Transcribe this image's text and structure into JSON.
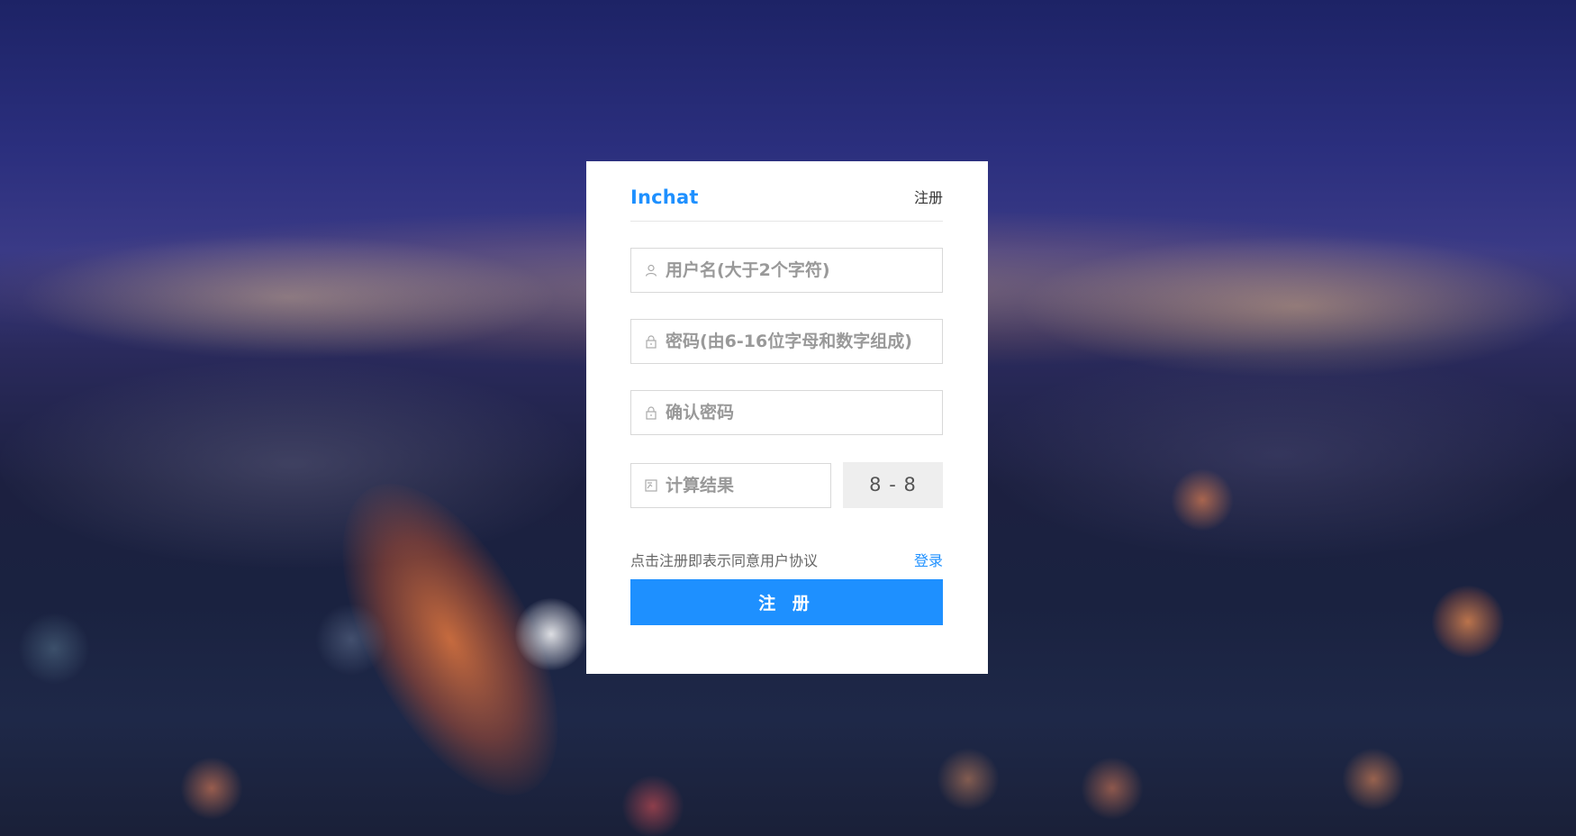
{
  "header": {
    "brand": "Inchat",
    "tab_label": "注册"
  },
  "form": {
    "username": {
      "placeholder": "用户名(大于2个字符)",
      "value": "",
      "icon": "user-icon"
    },
    "password": {
      "placeholder": "密码(由6-16位字母和数字组成)",
      "value": "",
      "icon": "lock-icon"
    },
    "confirm_password": {
      "placeholder": "确认密码",
      "value": "",
      "icon": "lock-icon"
    },
    "captcha": {
      "placeholder": "计算结果",
      "value": "",
      "icon": "calculator-icon",
      "question": "8 - 8"
    }
  },
  "footer": {
    "agreement_text": "点击注册即表示同意用户协议",
    "login_link": "登录",
    "submit_label": "注 册"
  },
  "colors": {
    "accent": "#1e90ff",
    "card_background": "#ffffff",
    "captcha_background": "#eeeeee"
  }
}
